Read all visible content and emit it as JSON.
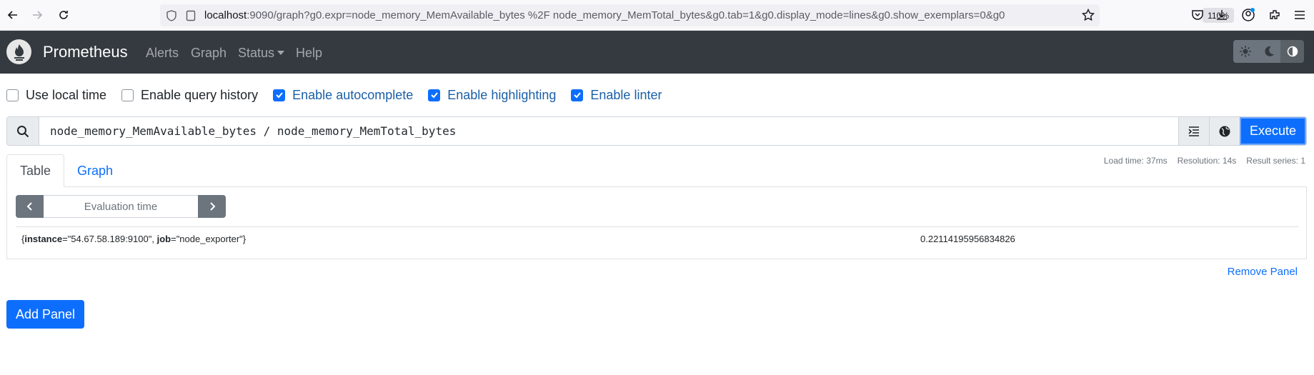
{
  "browser": {
    "url_host": "localhost",
    "url_rest": ":9090/graph?g0.expr=node_memory_MemAvailable_bytes %2F node_memory_MemTotal_bytes&g0.tab=1&g0.display_mode=lines&g0.show_exemplars=0&g0",
    "zoom": "110%"
  },
  "navbar": {
    "brand": "Prometheus",
    "links": {
      "alerts": "Alerts",
      "graph": "Graph",
      "status": "Status",
      "help": "Help"
    }
  },
  "options": {
    "use_local_time": {
      "label": "Use local time",
      "checked": false
    },
    "query_history": {
      "label": "Enable query history",
      "checked": false
    },
    "autocomplete": {
      "label": "Enable autocomplete",
      "checked": true
    },
    "highlighting": {
      "label": "Enable highlighting",
      "checked": true
    },
    "linter": {
      "label": "Enable linter",
      "checked": true
    }
  },
  "query": {
    "expression": "node_memory_MemAvailable_bytes / node_memory_MemTotal_bytes",
    "execute_label": "Execute"
  },
  "tabs": {
    "table": "Table",
    "graph": "Graph"
  },
  "stats": {
    "load_time": "Load time: 37ms",
    "resolution": "Resolution: 14s",
    "result_series": "Result series: 1"
  },
  "table": {
    "eval_time_placeholder": "Evaluation time",
    "rows": [
      {
        "label_instance_key": "instance",
        "label_instance_val": "\"54.67.58.189:9100\"",
        "label_job_key": "job",
        "label_job_val": "\"node_exporter\"",
        "value": "0.22114195956834826"
      }
    ]
  },
  "remove_panel": "Remove Panel",
  "add_panel": "Add Panel",
  "colors": {
    "accent": "#0d6efd",
    "navbar": "#343a40"
  }
}
